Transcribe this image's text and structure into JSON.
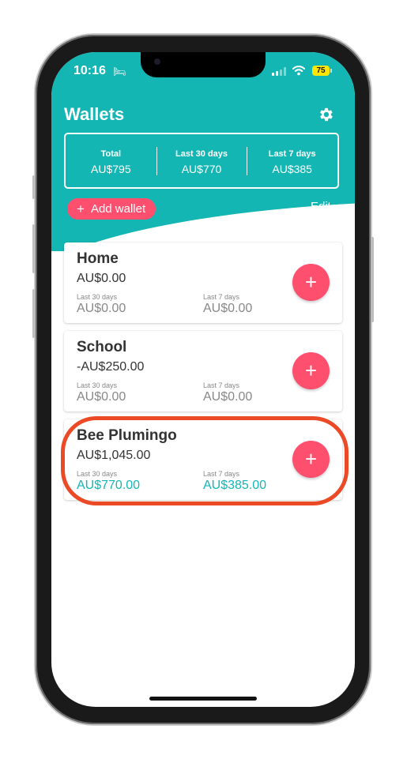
{
  "status_bar": {
    "time": "10:16",
    "battery": "75"
  },
  "header": {
    "title": "Wallets",
    "settings_icon": "gear-icon"
  },
  "summary": [
    {
      "label": "Total",
      "value": "AU$795"
    },
    {
      "label": "Last 30 days",
      "value": "AU$770"
    },
    {
      "label": "Last 7 days",
      "value": "AU$385"
    }
  ],
  "actions": {
    "add_wallet_label": "Add wallet",
    "edit_label": "Edit"
  },
  "wallets": [
    {
      "name": "Home",
      "balance": "AU$0.00",
      "last30_label": "Last 30 days",
      "last30_value": "AU$0.00",
      "last7_label": "Last 7 days",
      "last7_value": "AU$0.00"
    },
    {
      "name": "School",
      "balance": "-AU$250.00",
      "last30_label": "Last 30 days",
      "last30_value": "AU$0.00",
      "last7_label": "Last 7 days",
      "last7_value": "AU$0.00"
    },
    {
      "name": "Bee Plumingo",
      "balance": "AU$1,045.00",
      "last30_label": "Last 30 days",
      "last30_value": "AU$770.00",
      "last7_label": "Last 7 days",
      "last7_value": "AU$385.00"
    }
  ],
  "colors": {
    "accent": "#14b6b3",
    "add_button": "#ff4f6f",
    "highlight": "#ec4a26"
  }
}
